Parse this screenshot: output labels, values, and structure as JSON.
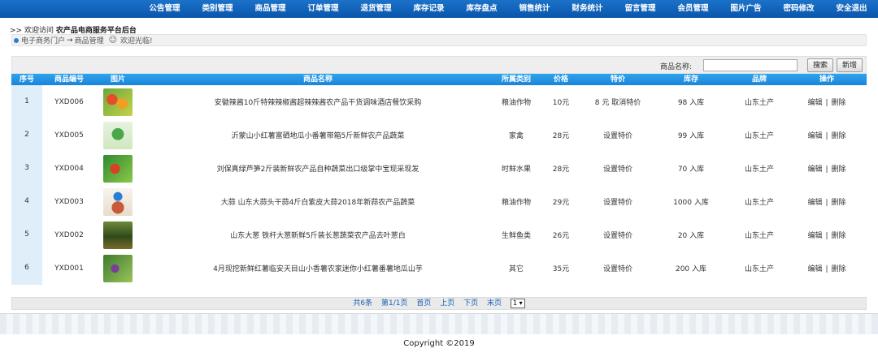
{
  "nav": {
    "items": [
      {
        "label": "公告管理"
      },
      {
        "label": "类别管理"
      },
      {
        "label": "商品管理"
      },
      {
        "label": "订单管理"
      },
      {
        "label": "退货管理"
      },
      {
        "label": "库存记录"
      },
      {
        "label": "库存盘点"
      },
      {
        "label": "销售统计"
      },
      {
        "label": "财务统计"
      },
      {
        "label": "留言管理"
      },
      {
        "label": "会员管理"
      },
      {
        "label": "图片广告"
      },
      {
        "label": "密码修改"
      },
      {
        "label": "安全退出"
      }
    ]
  },
  "welcome": {
    "prefix": ">> 欢迎访问",
    "site": "农产品电商服务平台后台"
  },
  "breadcrumb": {
    "home": "电子商务门户",
    "arrow": "→",
    "current": "商品管理",
    "greeting": "欢迎光临!"
  },
  "search": {
    "label": "商品名称:",
    "value": "",
    "search_button": "搜索",
    "add_button": "新增"
  },
  "table": {
    "headers": {
      "seq": "序号",
      "code": "商品编号",
      "image": "图片",
      "name": "商品名称",
      "category": "所属类别",
      "price": "价格",
      "special": "特价",
      "stock": "库存",
      "brand": "品牌",
      "ops": "操作"
    },
    "rows": [
      {
        "seq": "1",
        "code": "YXD006",
        "name": "安徽辣酱10斤特辣辣椒酱超辣辣酱农产品干货调味酒店餐饮采购",
        "category": "粮油作物",
        "price": "10元",
        "special": "8 元 取消特价",
        "stock": "98 入库",
        "brand": "山东土产",
        "edit": "编辑",
        "sep": "|",
        "delete": "删除"
      },
      {
        "seq": "2",
        "code": "YXD005",
        "name": "沂蒙山小红薯富硒地瓜小番薯带箱5斤新鲜农产品蔬菜",
        "category": "家禽",
        "price": "28元",
        "special": "设置特价",
        "stock": "99 入库",
        "brand": "山东土产",
        "edit": "编辑",
        "sep": "|",
        "delete": "删除"
      },
      {
        "seq": "3",
        "code": "YXD004",
        "name": "刘保真绿芦笋2斤装新鲜农产品自种蔬菜出口级掌中宝现采现发",
        "category": "时鲜水果",
        "price": "28元",
        "special": "设置特价",
        "stock": "70 入库",
        "brand": "山东土产",
        "edit": "编辑",
        "sep": "|",
        "delete": "删除"
      },
      {
        "seq": "4",
        "code": "YXD003",
        "name": "大蒜 山东大蒜头干蒜4斤白紫皮大蒜2018年新蒜农产品蔬菜",
        "category": "粮油作物",
        "price": "29元",
        "special": "设置特价",
        "stock": "1000 入库",
        "brand": "山东土产",
        "edit": "编辑",
        "sep": "|",
        "delete": "删除"
      },
      {
        "seq": "5",
        "code": "YXD002",
        "name": "山东大葱 铁杆大葱新鲜5斤装长葱蔬菜农产品去叶葱白",
        "category": "生鲜鱼类",
        "price": "26元",
        "special": "设置特价",
        "stock": "20 入库",
        "brand": "山东土产",
        "edit": "编辑",
        "sep": "|",
        "delete": "删除"
      },
      {
        "seq": "6",
        "code": "YXD001",
        "name": "4月现挖新鲜红薯临安天目山小香薯农家迷你小红薯番薯地瓜山芋",
        "category": "其它",
        "price": "35元",
        "special": "设置特价",
        "stock": "200 入库",
        "brand": "山东土产",
        "edit": "编辑",
        "sep": "|",
        "delete": "删除"
      }
    ]
  },
  "pager": {
    "total": "共6条",
    "page": "第1/1页",
    "first": "首页",
    "prev": "上页",
    "next": "下页",
    "last": "末页",
    "select": "1 ▾"
  },
  "footer": {
    "copyright": "Copyright ©2019"
  }
}
